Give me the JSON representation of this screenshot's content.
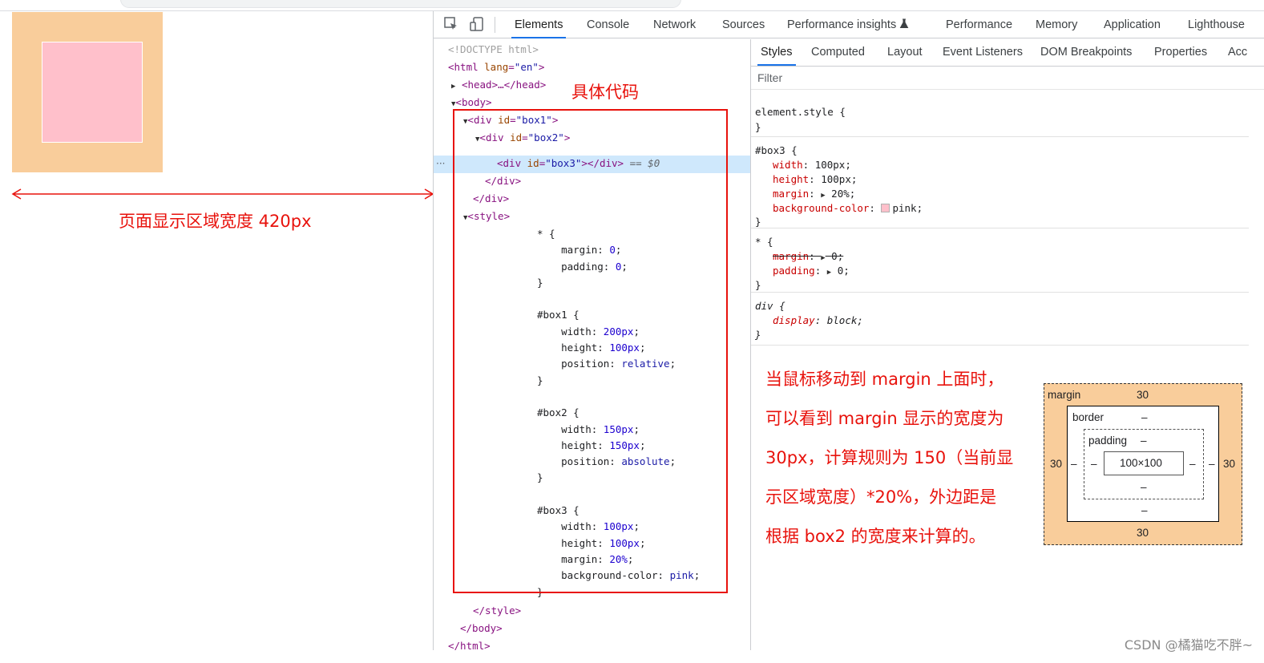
{
  "annotations": {
    "width_label": "页面显示区域宽度 420px",
    "code_label": "具体代码",
    "note_lines": [
      "当鼠标移动到 margin 上面时，",
      "可以看到 margin 显示的宽度为",
      "30px，计算规则为 150（当前显",
      "示区域宽度）*20%，外边距是",
      "根据 box2 的宽度来计算的。"
    ],
    "watermark": "CSDN @橘猫吃不胖~"
  },
  "devtools": {
    "tabs": [
      "Elements",
      "Console",
      "Network",
      "Sources",
      "Performance insights",
      "Performance",
      "Memory",
      "Application",
      "Lighthouse"
    ],
    "active_tab": "Elements",
    "flask_icon": "flask-icon",
    "styles_tabs": [
      "Styles",
      "Computed",
      "Layout",
      "Event Listeners",
      "DOM Breakpoints",
      "Properties",
      "Acc"
    ],
    "active_styles_tab": "Styles",
    "filter_placeholder": "Filter"
  },
  "elements_panel": {
    "doctype": "<!DOCTYPE html>",
    "html_open": "<html lang=\"en\">",
    "head": "<head>…</head>",
    "body_open": "<body>",
    "box1_open": "<div id=\"box1\">",
    "box2_open": "<div id=\"box2\">",
    "box3": "<div id=\"box3\"></div>",
    "selected_marker": "== $0",
    "div_close": "</div>",
    "style_open": "<style>",
    "style_close": "</style>",
    "body_close": "</body>",
    "html_close": "</html>",
    "css_lines": [
      "* {",
      "    margin: 0;",
      "    padding: 0;",
      "}",
      "",
      "#box1 {",
      "    width: 200px;",
      "    height: 100px;",
      "    position: relative;",
      "}",
      "",
      "#box2 {",
      "    width: 150px;",
      "    height: 150px;",
      "    position: absolute;",
      "}",
      "",
      "#box3 {",
      "    width: 100px;",
      "    height: 100px;",
      "    margin: 20%;",
      "    background-color: pink;",
      "}"
    ]
  },
  "styles_panel": {
    "element_style": "element.style {",
    "close": "}",
    "box3_rule": {
      "selector": "#box3 {",
      "props": [
        {
          "name": "width",
          "value": "100px;"
        },
        {
          "name": "height",
          "value": "100px;"
        },
        {
          "name": "margin",
          "value": "20%;"
        },
        {
          "name": "background-color",
          "value": "pink;"
        }
      ]
    },
    "star_rule": {
      "selector": "* {",
      "props": [
        {
          "name": "margin",
          "value": "0;"
        },
        {
          "name": "padding",
          "value": "0;"
        }
      ]
    },
    "div_rule": {
      "selector": "div {",
      "props": [
        {
          "name": "display",
          "value": "block;"
        }
      ]
    }
  },
  "box_model": {
    "margin_label": "margin",
    "margin_top": "30",
    "margin_bottom": "30",
    "margin_left": "30",
    "margin_right": "30",
    "border_label": "border",
    "border_dash": "–",
    "padding_label": "padding",
    "content": "100×100"
  },
  "colors": {
    "annotation_red": "#e8120c",
    "margin_orange": "#f9cd9b",
    "pink": "#ffc0cb",
    "devtools_accent": "#1a73e8"
  }
}
